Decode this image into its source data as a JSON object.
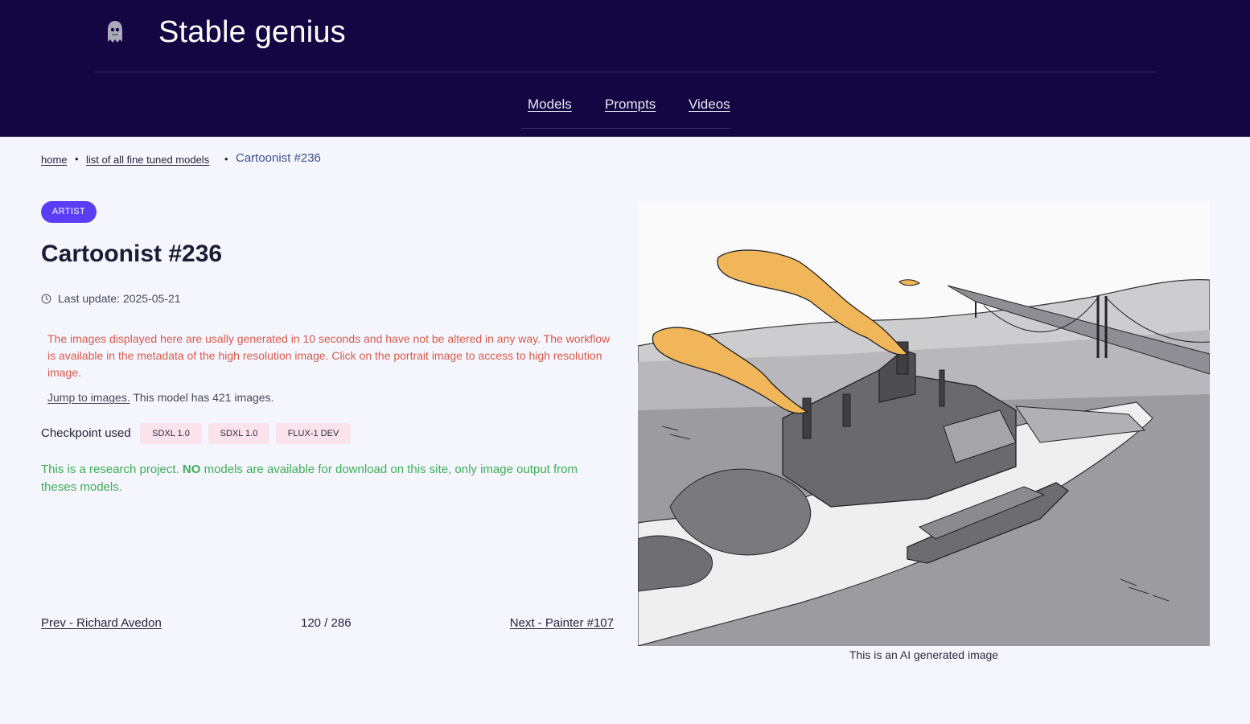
{
  "site": {
    "title": "Stable genius",
    "logo_icon": "ghost-icon"
  },
  "nav": {
    "items": [
      "Models",
      "Prompts",
      "Videos"
    ]
  },
  "breadcrumb": {
    "items": [
      "home",
      "list of all fine tuned models"
    ],
    "separator": "•",
    "current": "Cartoonist #236"
  },
  "model": {
    "badge": "ARTIST",
    "title": "Cartoonist #236",
    "last_update_label": "Last update: 2025-05-21",
    "notice": "The images displayed here are usally generated in 10 seconds and have not be altered in any way. The workflow is available in the metadata of the high resolution image. Click on the portrait image to access to high resolution image.",
    "jump_link": "Jump to images.",
    "image_count_text": "This model has 421 images.",
    "checkpoint_label": "Checkpoint used",
    "checkpoints": [
      "SDXL 1.0",
      "SDXL 1.0",
      "FLUX-1 DEV"
    ],
    "research_prefix": "This is a research project. ",
    "research_bold": "NO",
    "research_suffix": " models are available for download on this site, only image output from theses models."
  },
  "pager": {
    "prev": "Prev - Richard Avedon",
    "position": "120 / 286",
    "next": "Next - Painter #107"
  },
  "image": {
    "caption": "This is an AI generated image"
  },
  "colors": {
    "header_bg": "#140642",
    "page_bg": "#f5f6fd",
    "badge_bg": "#5b3df5",
    "notice_text": "#d65a4b",
    "research_text": "#3bae55",
    "chip_bg": "#fbe3ec",
    "smoke": "#f1b65a"
  }
}
